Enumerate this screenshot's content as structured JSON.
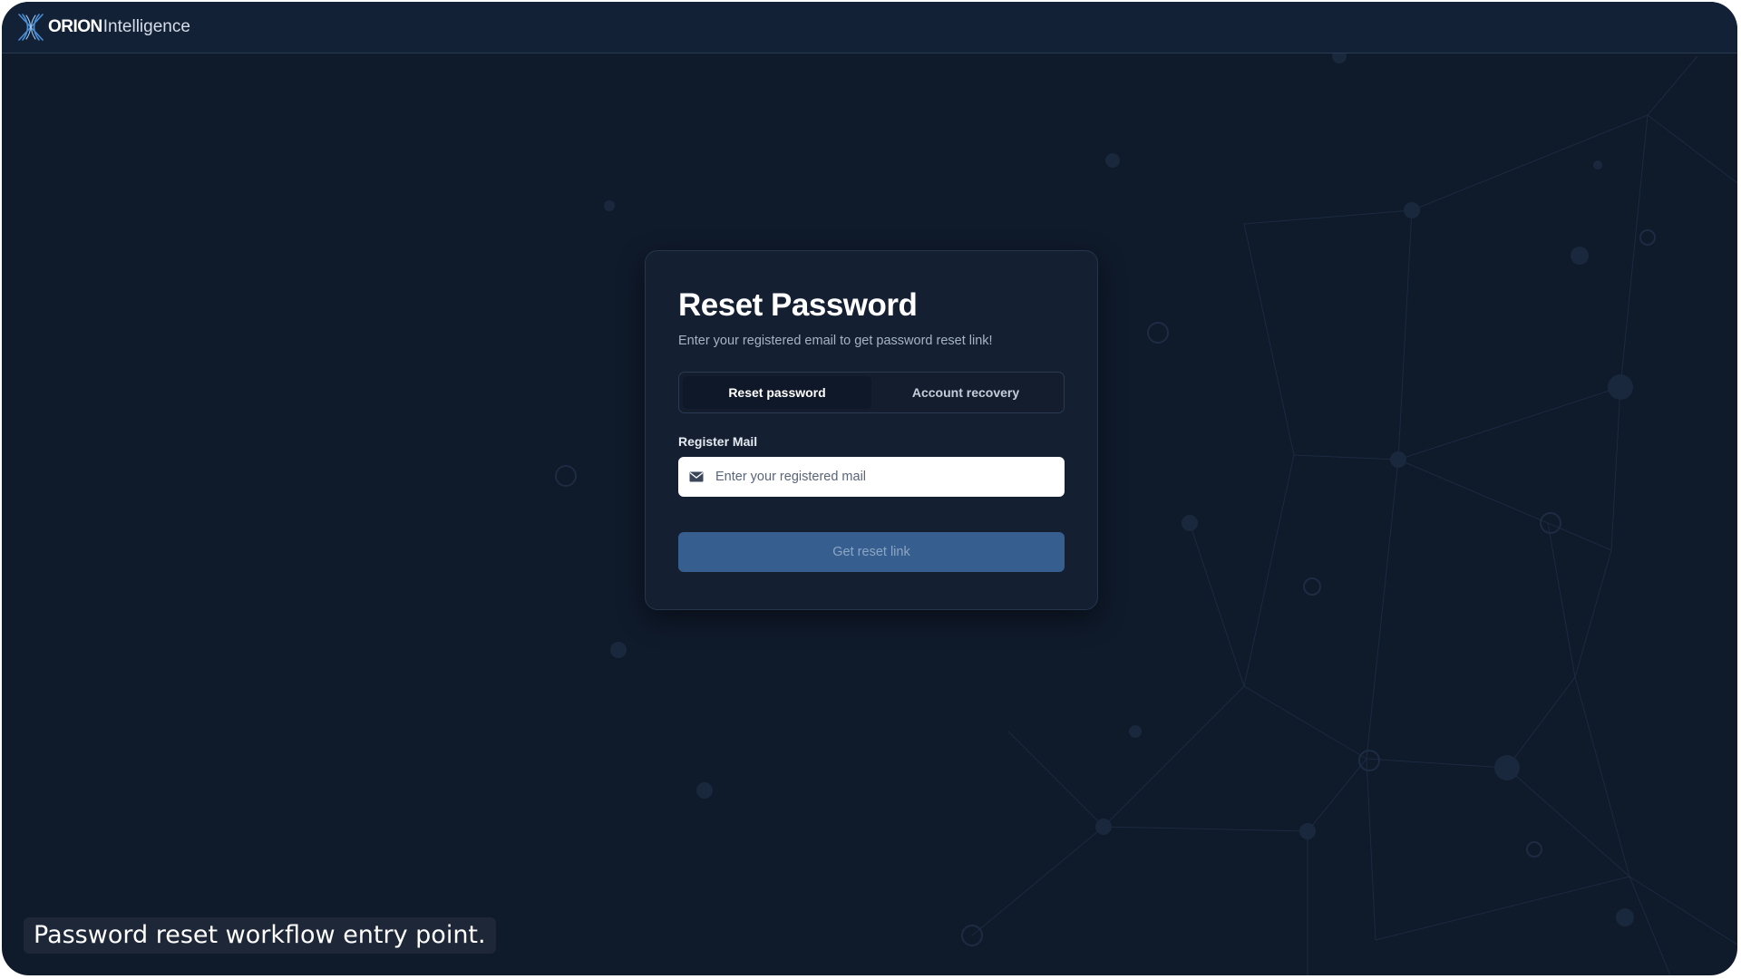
{
  "brand": {
    "name_bold": "ORION",
    "name_light": "Intelligence",
    "logo_icon": "orion-x-logo-icon"
  },
  "card": {
    "title": "Reset Password",
    "subtitle": "Enter your registered email to get password reset link!",
    "tabs": [
      {
        "label": "Reset password",
        "active": true
      },
      {
        "label": "Account recovery",
        "active": false
      }
    ],
    "email_label": "Register Mail",
    "email_icon": "mail-icon",
    "email_value": "",
    "email_placeholder": "Enter your registered mail",
    "submit_label": "Get reset link"
  },
  "caption": "Password reset workflow entry point.",
  "colors": {
    "background": "#0f1a2b",
    "topbar": "#132136",
    "card": "#141f32",
    "button": "#365f8f",
    "button_text": "#8da6c4",
    "logo_accent": "#4a8fd6"
  }
}
